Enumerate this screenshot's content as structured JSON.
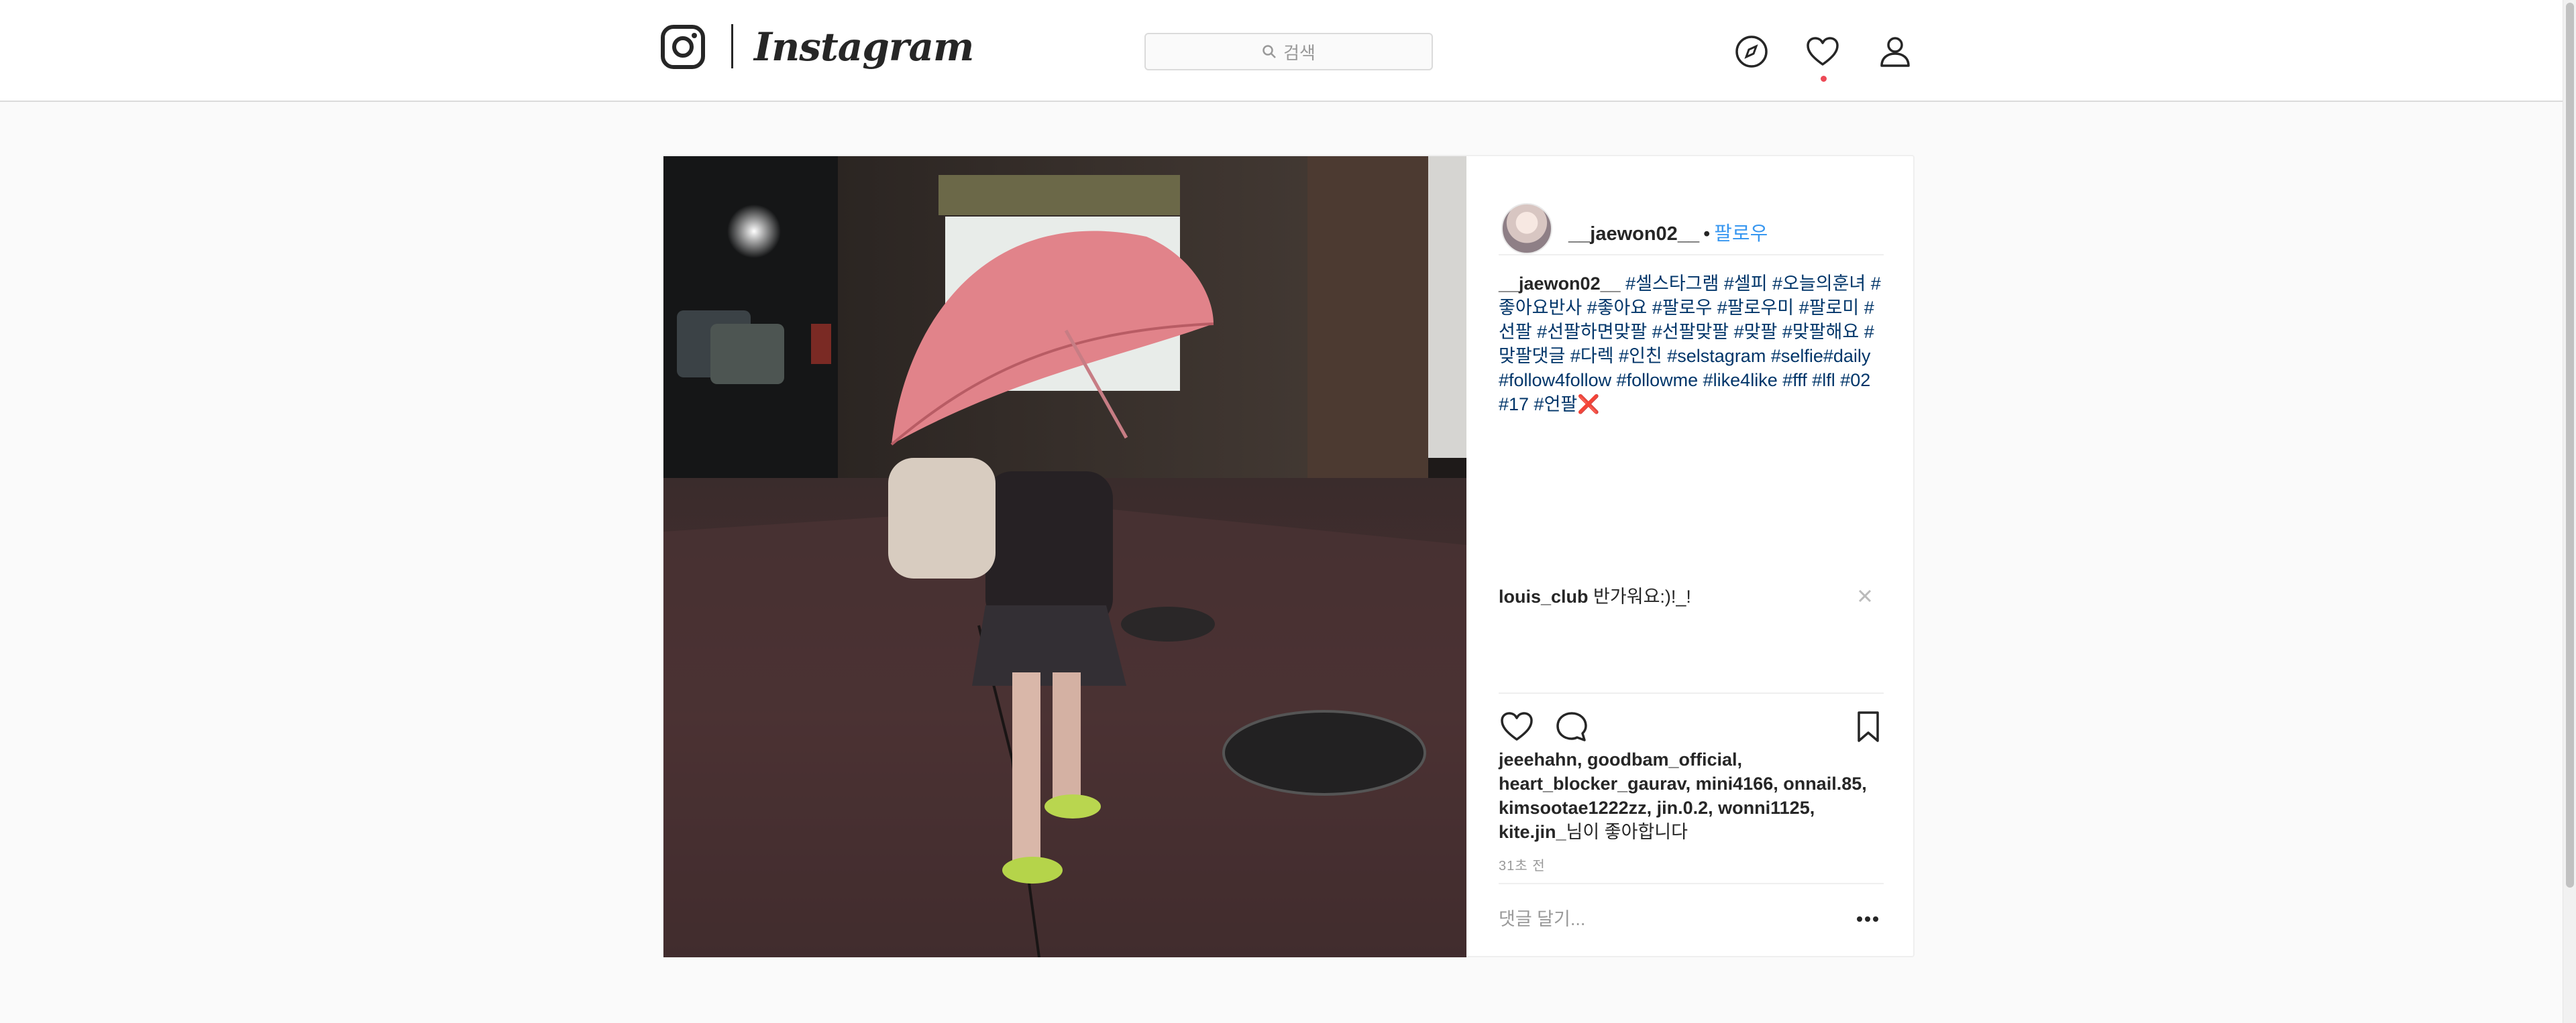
{
  "app": {
    "title": "Instagram",
    "brand_color": "#262626",
    "link_color": "#3897f0",
    "notification_color": "#ed4956"
  },
  "nav": {
    "search_icon": "search-icon",
    "search_placeholder": "검색",
    "explore_icon": "compass-icon",
    "activity_icon": "heart-icon",
    "profile_icon": "user-icon"
  },
  "post": {
    "username": "__jaewon02__",
    "follow_label": "팔로우",
    "caption_author": "__jaewon02__",
    "caption_tags": "#셀스타그램 #셀피 #오늘의훈녀 #좋아요반사 #좋아요 #팔로우 #팔로우미 #팔로미 #선팔 #선팔하면맞팔 #선팔맞팔 #맞팔 #맞팔해요 #맞팔댓글 #다렉 #인친 #selstagram #selfie#daily #follow4follow #followme #like4like #fff #lfl #02 #17 #언팔",
    "caption_emoji": "❌",
    "comment": {
      "author": "louis_club",
      "text": "반가워요:)!_!"
    },
    "likes_names": "jeeehahn, goodbam_official, heart_blocker_gaurav, mini4166, onnail.85, kimsootae1222zz, jin.0.2, wonni1125, kite.jin_",
    "likes_suffix": "님이 좋아합니다",
    "time": "31초 전",
    "comment_placeholder": "댓글 달기...",
    "more_label": "..."
  },
  "icons": {
    "like": "heart-outline-icon",
    "comment": "comment-bubble-icon",
    "save": "bookmark-icon",
    "close": "close-icon",
    "more": "more-dots-icon"
  }
}
